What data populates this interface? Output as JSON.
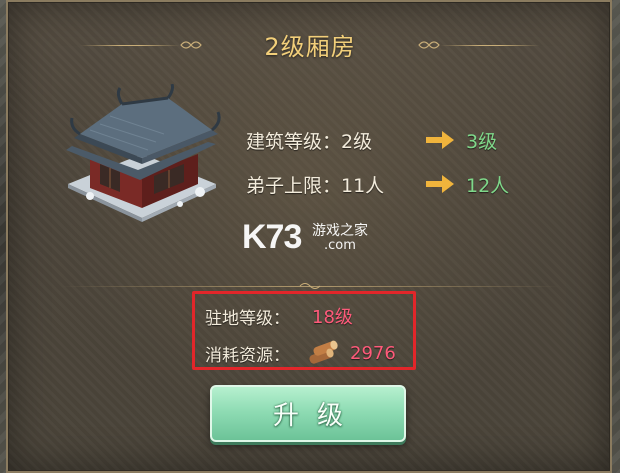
{
  "dialog": {
    "title": "2级厢房"
  },
  "upgrade_info": {
    "building_level": {
      "label": "建筑等级：2级",
      "new_value": "3级"
    },
    "disciple_cap": {
      "label": "弟子上限：11人",
      "new_value": "12人"
    }
  },
  "requirements": {
    "station_level": {
      "label": "驻地等级：",
      "value": "18级"
    },
    "resource_cost": {
      "label": "消耗资源：",
      "value": "2976",
      "icon": "wood-logs-icon"
    }
  },
  "buttons": {
    "upgrade_label": "升级"
  },
  "watermark": {
    "brand": "K73",
    "site_cn": "游戏之家",
    "site_domain": ".com"
  },
  "colors": {
    "title": "#f2cf7a",
    "next_value": "#7fd88a",
    "cost_value": "#ff5a7a",
    "highlight_border": "#e2262a",
    "button": "#8fdcb4"
  }
}
